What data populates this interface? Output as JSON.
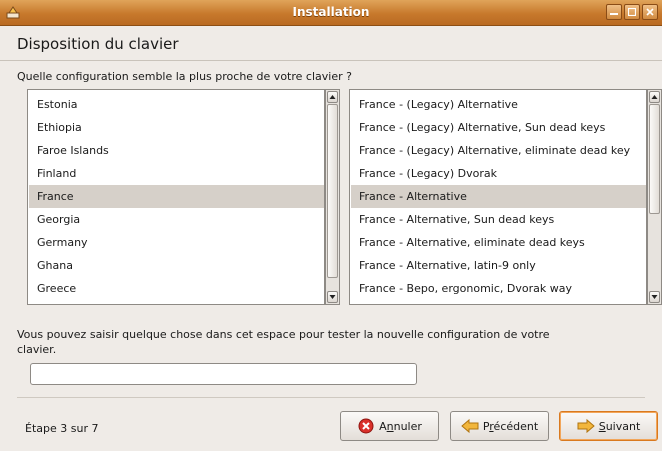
{
  "window": {
    "title": "Installation"
  },
  "header": {
    "title": "Disposition du clavier"
  },
  "question": "Quelle configuration semble la plus proche de votre clavier ?",
  "countries": {
    "items": [
      "Estonia",
      "Ethiopia",
      "Faroe Islands",
      "Finland",
      "France",
      "Georgia",
      "Germany",
      "Ghana",
      "Greece"
    ],
    "selected": "France"
  },
  "variants": {
    "items": [
      "France - (Legacy) Alternative",
      "France - (Legacy) Alternative, Sun dead keys",
      "France - (Legacy) Alternative, eliminate dead key",
      "France - (Legacy) Dvorak",
      "France - Alternative",
      "France - Alternative, Sun dead keys",
      "France - Alternative, eliminate dead keys",
      "France - Alternative, latin-9 only",
      "France - Bepo, ergonomic, Dvorak way"
    ],
    "selected": "France - Alternative"
  },
  "test": {
    "label": "Vous pouvez saisir quelque chose dans cet espace pour tester la nouvelle configuration de votre clavier.",
    "value": ""
  },
  "footer": {
    "step": "Étape 3 sur 7",
    "cancel_first": "A",
    "cancel_mnemonic": "n",
    "cancel_rest": "nuler",
    "back_first": "P",
    "back_mnemonic": "r",
    "back_rest": "écédent",
    "next_mnemonic": "S",
    "next_rest": "uivant"
  },
  "colors": {
    "titlebar": "#c7792c",
    "selection": "#d6d0c9",
    "focus": "#d9791f"
  }
}
